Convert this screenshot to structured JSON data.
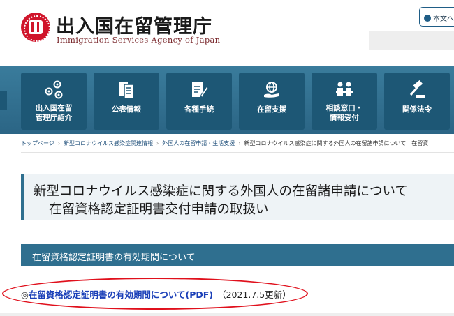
{
  "header": {
    "agency_name": "出入国在留管理庁",
    "agency_en": "Immigration Services Agency of Japan",
    "lang_label": "本文へ"
  },
  "nav": {
    "items": [
      {
        "label_1": "出入国在留",
        "label_2": "管理庁紹介",
        "icon": "people-network-icon"
      },
      {
        "label_1": "公表情報",
        "label_2": "",
        "icon": "documents-icon"
      },
      {
        "label_1": "各種手続",
        "label_2": "",
        "icon": "form-pen-icon"
      },
      {
        "label_1": "在留支援",
        "label_2": "",
        "icon": "globe-hand-icon"
      },
      {
        "label_1": "相談窓口・",
        "label_2": "情報受付",
        "icon": "consultation-icon"
      },
      {
        "label_1": "関係法令",
        "label_2": "",
        "icon": "gavel-icon"
      }
    ]
  },
  "breadcrumb": {
    "items": [
      "トップページ",
      "新型コロナウイルス感染症関連情報",
      "外国人の在留申請・生活支援",
      "新型コロナウイルス感染症に関する外国人の在留諸申請について　在留資"
    ]
  },
  "page": {
    "title_line1": "新型コロナウイルス感染症に関する外国人の在留諸申請について",
    "title_line2": "在留資格認定証明書交付申請の取扱い",
    "section_heading": "在留資格認定証明書の有効期間について",
    "link_prefix": "◎",
    "link_text": "在留資格認定証明書の有効期間について(PDF)",
    "link_date": "（2021.7.5更新）"
  },
  "colors": {
    "nav_band": "#2f6f8f",
    "nav_tile": "#1d5775",
    "highlight_oval": "#e0101c",
    "link": "#1a3fb8"
  }
}
